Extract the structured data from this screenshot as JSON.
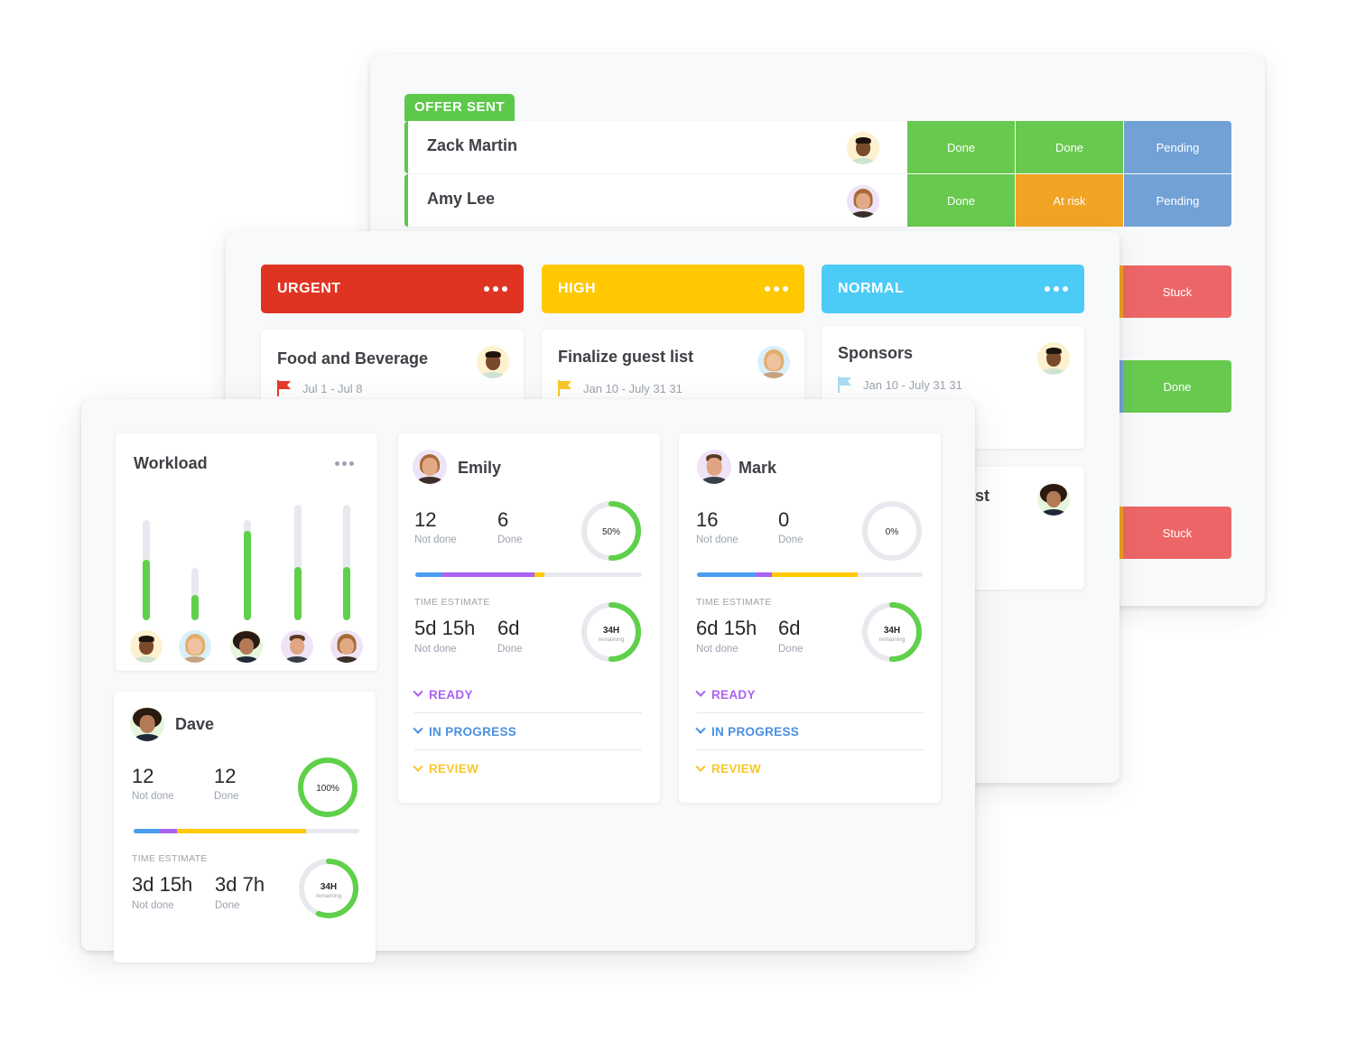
{
  "colors": {
    "green": "#68c94f",
    "orange": "#f1a323",
    "blue": "#72a1d6",
    "red": "#ec6667",
    "urgent": "#e03423",
    "high": "#ffc800",
    "normal": "#4ccbf7",
    "ready": "#a963f2",
    "in_progress": "#4a90e2",
    "review": "#f8c72b"
  },
  "pipeline": {
    "group_label": "OFFER SENT",
    "rows": [
      {
        "name": "Zack Martin",
        "avatar": "avatar-man-1",
        "statuses": [
          "Done",
          "Done",
          "Pending"
        ]
      },
      {
        "name": "Amy Lee",
        "avatar": "avatar-woman-2",
        "statuses": [
          "Done",
          "At risk",
          "Pending"
        ]
      }
    ],
    "side_statuses": [
      "Stuck",
      "Done",
      "Stuck"
    ]
  },
  "board": {
    "columns": [
      {
        "label": "URGENT",
        "card": {
          "title": "Food and Beverage",
          "date": "Jul 1 - Jul 8",
          "flag": "red-flag-icon"
        }
      },
      {
        "label": "HIGH",
        "card": {
          "title": "Finalize guest list",
          "date": "Jan 10 - July 31 31",
          "flag": "yellow-flag-icon"
        }
      },
      {
        "label": "NORMAL",
        "card": {
          "title": "Sponsors",
          "date": "Jan 10 - July 31 31",
          "flag": "blue-flag-icon"
        },
        "second_card_title_fragment": "st"
      }
    ]
  },
  "workload": {
    "title": "Workload",
    "bars": [
      {
        "person": "Zack",
        "capacity": 0.87,
        "assigned": 0.52
      },
      {
        "person": "Amy",
        "capacity": 0.45,
        "assigned": 0.22
      },
      {
        "person": "Dave",
        "capacity": 0.87,
        "assigned": 0.77
      },
      {
        "person": "Mark",
        "capacity": 1.0,
        "assigned": 0.46
      },
      {
        "person": "Emily",
        "capacity": 1.0,
        "assigned": 0.46
      }
    ]
  },
  "people": [
    {
      "name": "Emily",
      "not_done": "12",
      "done": "6",
      "not_done_label": "Not done",
      "done_label": "Done",
      "percent_label": "50%",
      "percent": 50,
      "progress_segments": [
        0.116,
        0.41,
        0.044
      ],
      "time_estimate_label": "TIME ESTIMATE",
      "time_not_done": "5d 15h",
      "time_done": "6d",
      "remaining_value": "34H",
      "remaining_label": "remaining",
      "remaining_percent": 50,
      "statuses": [
        "READY",
        "IN PROGRESS",
        "REVIEW"
      ]
    },
    {
      "name": "Mark",
      "not_done": "16",
      "done": "0",
      "not_done_label": "Not done",
      "done_label": "Done",
      "percent_label": "0%",
      "percent": 0,
      "progress_segments": [
        0.26,
        0.072,
        0.38
      ],
      "time_estimate_label": "TIME ESTIMATE",
      "time_not_done": "6d 15h",
      "time_done": "6d",
      "remaining_value": "34H",
      "remaining_label": "remaining",
      "remaining_percent": 50,
      "statuses": [
        "READY",
        "IN PROGRESS",
        "REVIEW"
      ]
    },
    {
      "name": "Dave",
      "not_done": "12",
      "done": "12",
      "not_done_label": "Not done",
      "done_label": "Done",
      "percent_label": "100%",
      "percent": 100,
      "progress_segments": [
        0.116,
        0.076,
        0.57
      ],
      "time_estimate_label": "TIME ESTIMATE",
      "time_not_done": "3d 15h",
      "time_done": "3d 7h",
      "remaining_value": "34H",
      "remaining_label": "remaining",
      "remaining_percent": 56
    }
  ]
}
